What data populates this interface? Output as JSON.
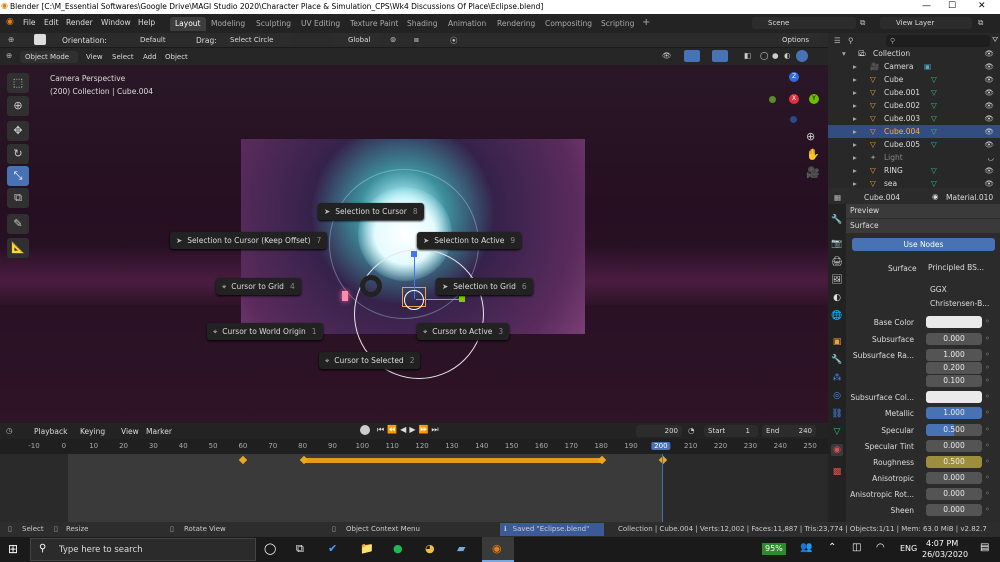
{
  "title_bar": {
    "title": "Blender [C:\\M_Essential Softwares\\Google Drive\\MAGI Studio 2020\\Character Place & Simulation_CPS\\Wk4 Discussions Of Place\\Eclipse.blend]",
    "minimize": "—",
    "maximize": "☐",
    "close": "✕"
  },
  "menu": [
    "File",
    "Edit",
    "Render",
    "Window",
    "Help"
  ],
  "workspaces": [
    "Layout",
    "Modeling",
    "Sculpting",
    "UV Editing",
    "Texture Paint",
    "Shading",
    "Animation",
    "Rendering",
    "Compositing",
    "Scripting"
  ],
  "workspace_add": "+",
  "scene": {
    "label": "Scene",
    "view_layer": "View Layer"
  },
  "toolbar": {
    "orientation_label": "Orientation:",
    "orientation_value": "Default",
    "drag_label": "Drag:",
    "drag_value": "Select Circle",
    "transform": "Global",
    "options": "Options"
  },
  "viewport_header": {
    "mode": "Object Mode",
    "view": "View",
    "select": "Select",
    "add": "Add",
    "object": "Object"
  },
  "viewport_overlay": {
    "line1": "Camera Perspective",
    "line2": "(200) Collection | Cube.004"
  },
  "gizmo": {
    "x": "X",
    "y": "Y",
    "z": "Z"
  },
  "pie_menu": [
    {
      "label": "Selection to Cursor",
      "num": "8"
    },
    {
      "label": "Selection to Cursor (Keep Offset)",
      "num": "7"
    },
    {
      "label": "Selection to Active",
      "num": "9"
    },
    {
      "label": "Cursor to Grid",
      "num": "4"
    },
    {
      "label": "Selection to Grid",
      "num": "6"
    },
    {
      "label": "Cursor to World Origin",
      "num": "1"
    },
    {
      "label": "Cursor to Active",
      "num": "3"
    },
    {
      "label": "Cursor to Selected",
      "num": "2"
    }
  ],
  "timeline": {
    "playback": "Playback",
    "keying": "Keying",
    "view": "View",
    "marker": "Marker",
    "current_frame": "200",
    "start_label": "Start",
    "start": "1",
    "end_label": "End",
    "end": "240",
    "ticks": [
      "-10",
      "0",
      "10",
      "20",
      "30",
      "40",
      "50",
      "60",
      "70",
      "80",
      "90",
      "100",
      "110",
      "120",
      "130",
      "140",
      "150",
      "160",
      "170",
      "180",
      "190",
      "200",
      "210",
      "220",
      "230",
      "240",
      "250"
    ]
  },
  "outliner": {
    "search_placeholder": "",
    "rows": [
      {
        "name": "Collection",
        "type": "collection"
      },
      {
        "name": "Camera",
        "type": "camera"
      },
      {
        "name": "Cube",
        "type": "mesh"
      },
      {
        "name": "Cube.001",
        "type": "mesh"
      },
      {
        "name": "Cube.002",
        "type": "mesh"
      },
      {
        "name": "Cube.003",
        "type": "mesh"
      },
      {
        "name": "Cube.004",
        "type": "mesh",
        "selected": true
      },
      {
        "name": "Cube.005",
        "type": "mesh"
      },
      {
        "name": "Light",
        "type": "light"
      },
      {
        "name": "RING",
        "type": "mesh"
      },
      {
        "name": "sea",
        "type": "mesh"
      }
    ]
  },
  "properties": {
    "object": "Cube.004",
    "material": "Material.010",
    "preview": "Preview",
    "surface_panel": "Surface",
    "use_nodes": "Use Nodes",
    "surface_label": "Surface",
    "surface_value": "Principled BS...",
    "distribution": "GGX",
    "subsurface_method": "Christensen-B...",
    "fields": [
      {
        "label": "Base Color",
        "value": "",
        "kind": "color-white"
      },
      {
        "label": "Subsurface",
        "value": "0.000",
        "kind": "num"
      },
      {
        "label": "Subsurface Ra...",
        "value": "1.000",
        "kind": "num"
      },
      {
        "label": "",
        "value": "0.200",
        "kind": "num"
      },
      {
        "label": "",
        "value": "0.100",
        "kind": "num"
      },
      {
        "label": "Subsurface Col...",
        "value": "",
        "kind": "color-white"
      },
      {
        "label": "Metallic",
        "value": "1.000",
        "kind": "blue-full"
      },
      {
        "label": "Specular",
        "value": "0.500",
        "kind": "blue-half"
      },
      {
        "label": "Specular Tint",
        "value": "0.000",
        "kind": "num"
      },
      {
        "label": "Roughness",
        "value": "0.500",
        "kind": "yellow-half"
      },
      {
        "label": "Anisotropic",
        "value": "0.000",
        "kind": "num"
      },
      {
        "label": "Anisotropic Rot...",
        "value": "0.000",
        "kind": "num"
      },
      {
        "label": "Sheen",
        "value": "0.000",
        "kind": "num"
      }
    ]
  },
  "status": {
    "select": "Select",
    "resize": "Resize",
    "rotate": "Rotate View",
    "context": "Object Context Menu",
    "saved": "Saved \"Eclipse.blend\"",
    "info": "Collection | Cube.004 | Verts:12,002 | Faces:11,887 | Tris:23,774 | Objects:1/11 | Mem: 63.0 MiB | v2.82.7"
  },
  "taskbar": {
    "search": "Type here to search",
    "battery": "95%",
    "lang": "ENG",
    "time": "4:07 PM",
    "date": "26/03/2020"
  },
  "colors": {
    "accent": "#4772b3",
    "orange": "#f0a040",
    "keyframe_bar": "#e39a1d"
  }
}
